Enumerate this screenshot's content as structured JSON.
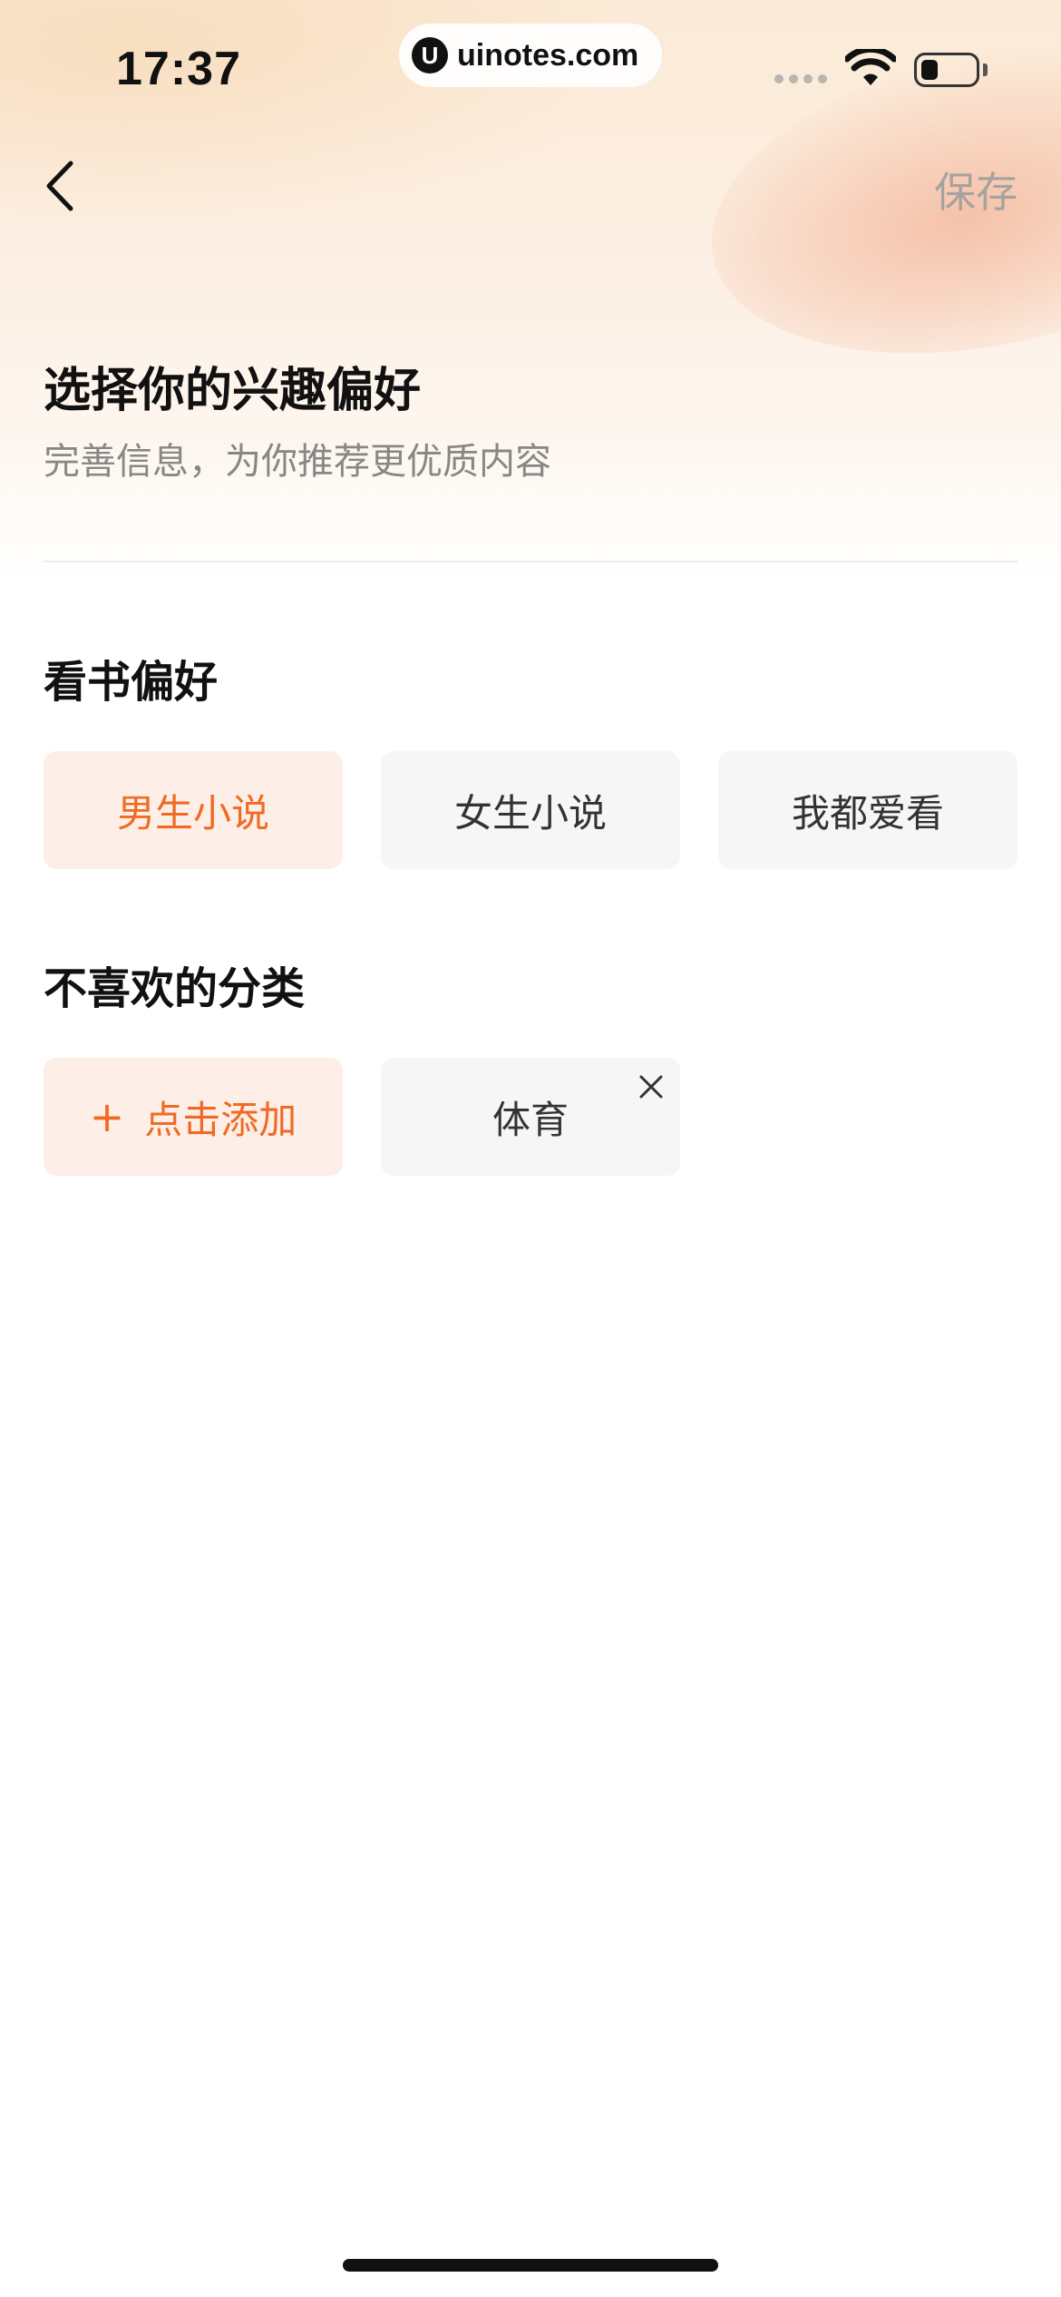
{
  "status_bar": {
    "time": "17:37",
    "url": "uinotes.com",
    "logo_glyph": "U"
  },
  "nav": {
    "back_icon": "chevron-left-icon",
    "save_label": "保存"
  },
  "header": {
    "title": "选择你的兴趣偏好",
    "subtitle": "完善信息，为你推荐更优质内容"
  },
  "reading_preference": {
    "label": "看书偏好",
    "options": [
      {
        "label": "男生小说",
        "selected": true
      },
      {
        "label": "女生小说",
        "selected": false
      },
      {
        "label": "我都爱看",
        "selected": false
      }
    ]
  },
  "disliked_categories": {
    "label": "不喜欢的分类",
    "add_plus": "+",
    "add_label": "点击添加",
    "items": [
      {
        "label": "体育",
        "close_icon": "close-icon"
      }
    ]
  },
  "colors": {
    "accent": "#f06a24",
    "accent_bg": "#fdefe7",
    "chip_bg": "#f6f6f6",
    "muted_text": "#8a8683"
  }
}
